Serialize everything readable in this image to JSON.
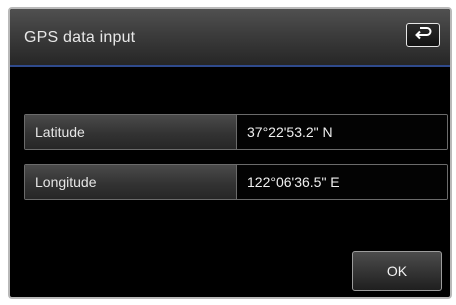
{
  "header": {
    "title": "GPS data input",
    "back_icon": "return-arrow-icon"
  },
  "fields": [
    {
      "label": "Latitude",
      "value": "37°22'53.2\" N"
    },
    {
      "label": "Longitude",
      "value": "122°06'36.5\" E"
    }
  ],
  "footer": {
    "ok_label": "OK"
  },
  "colors": {
    "background": "#000000",
    "header_accent_line": "#2f4a8c",
    "text": "#e8e8e8"
  }
}
